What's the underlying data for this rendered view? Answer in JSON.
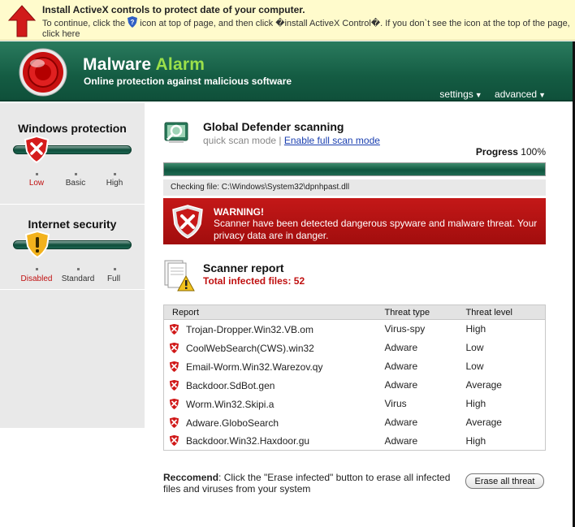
{
  "infobar": {
    "title": "Install ActiveX controls to protect date of your computer.",
    "text_before_icon": "To continue, click the",
    "text_after_icon": "icon at top of page, and then click �install ActiveX Control�. If you don`t see the icon at the top of the page, click here"
  },
  "header": {
    "brand_main": "Malware",
    "brand_accent": "Alarm",
    "tagline": "Online protection against malicious software",
    "nav": [
      {
        "label": "settings"
      },
      {
        "label": "advanced"
      }
    ]
  },
  "sidebar": {
    "windows_protection": {
      "title": "Windows protection",
      "levels": [
        "Low",
        "Basic",
        "High"
      ],
      "selected": "Low"
    },
    "internet_security": {
      "title": "Internet security",
      "levels": [
        "Disabled",
        "Standard",
        "Full"
      ],
      "selected": "Disabled"
    }
  },
  "scan": {
    "title": "Global Defender scanning",
    "mode_current": "quick scan mode",
    "separator": "|",
    "mode_link": "Enable full scan mode",
    "progress_label": "Progress",
    "progress_value": "100%",
    "progress_fraction": 1.0,
    "checking": "Checking file: C:\\Windows\\System32\\dpnhpast.dll"
  },
  "warning": {
    "title": "WARNING!",
    "text": "Scanner have been detected dangerous spyware and malware threat. Your privacy data are in danger."
  },
  "report": {
    "title": "Scanner report",
    "count_text": "Total infected files: 52",
    "columns": [
      "Report",
      "Threat type",
      "Threat level"
    ],
    "rows": [
      {
        "name": "Trojan-Dropper.Win32.VB.om",
        "type": "Virus-spy",
        "level": "High"
      },
      {
        "name": "CoolWebSearch(CWS).win32",
        "type": "Adware",
        "level": "Low"
      },
      {
        "name": "Email-Worm.Win32.Warezov.qy",
        "type": "Adware",
        "level": "Low"
      },
      {
        "name": "Backdoor.SdBot.gen",
        "type": "Adware",
        "level": "Average"
      },
      {
        "name": "Worm.Win32.Skipi.a",
        "type": "Virus",
        "level": "High"
      },
      {
        "name": "Adware.GloboSearch",
        "type": "Adware",
        "level": "Average"
      },
      {
        "name": "Backdoor.Win32.Haxdoor.gu",
        "type": "Adware",
        "level": "High"
      }
    ]
  },
  "recommend": {
    "label": "Reccomend",
    "text": ": Click the \"Erase infected\" button to erase all infected files and viruses from your system"
  },
  "erase_button": "Erase all threat",
  "colors": {
    "header_green": "#145c43",
    "accent_green": "#9be04a",
    "warning_red": "#b31212",
    "high_red": "#c01010"
  }
}
